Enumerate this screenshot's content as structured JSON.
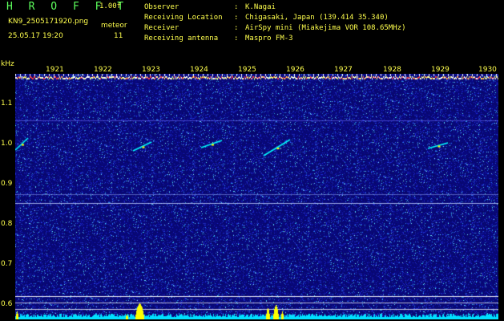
{
  "header": {
    "app_title": "H R O F F T",
    "version": "1.00f",
    "file_name": "KN9_2505171920.png",
    "mode": "meteor",
    "timestamp": "25.05.17 19:20",
    "count": "11"
  },
  "station_info": [
    {
      "key": "Observer",
      "value": "K.Nagai"
    },
    {
      "key": "Receiving Location",
      "value": "Chigasaki, Japan (139.414 35.340)"
    },
    {
      "key": "Receiver",
      "value": "AirSpy mini (Miakejima VOR 108.65MHz)"
    },
    {
      "key": "Receiving antenna",
      "value": "Maspro FM-3"
    }
  ],
  "axis": {
    "y_unit": "kHz",
    "y_ticks": [
      "1.1",
      "1.0",
      "0.9",
      "0.8",
      "0.7",
      "0.6"
    ],
    "x_ticks": [
      "1921",
      "1922",
      "1923",
      "1924",
      "1925",
      "1926",
      "1927",
      "1928",
      "1929",
      "1930"
    ]
  },
  "colors": {
    "header_green": "#5dff5d",
    "label_yellow": "#ffff4d",
    "noise_floor": "#0a0a6e",
    "carrier_line": "#ffffff",
    "signal_trace": "#00ffff",
    "burst_peak": "#ffff00"
  }
}
